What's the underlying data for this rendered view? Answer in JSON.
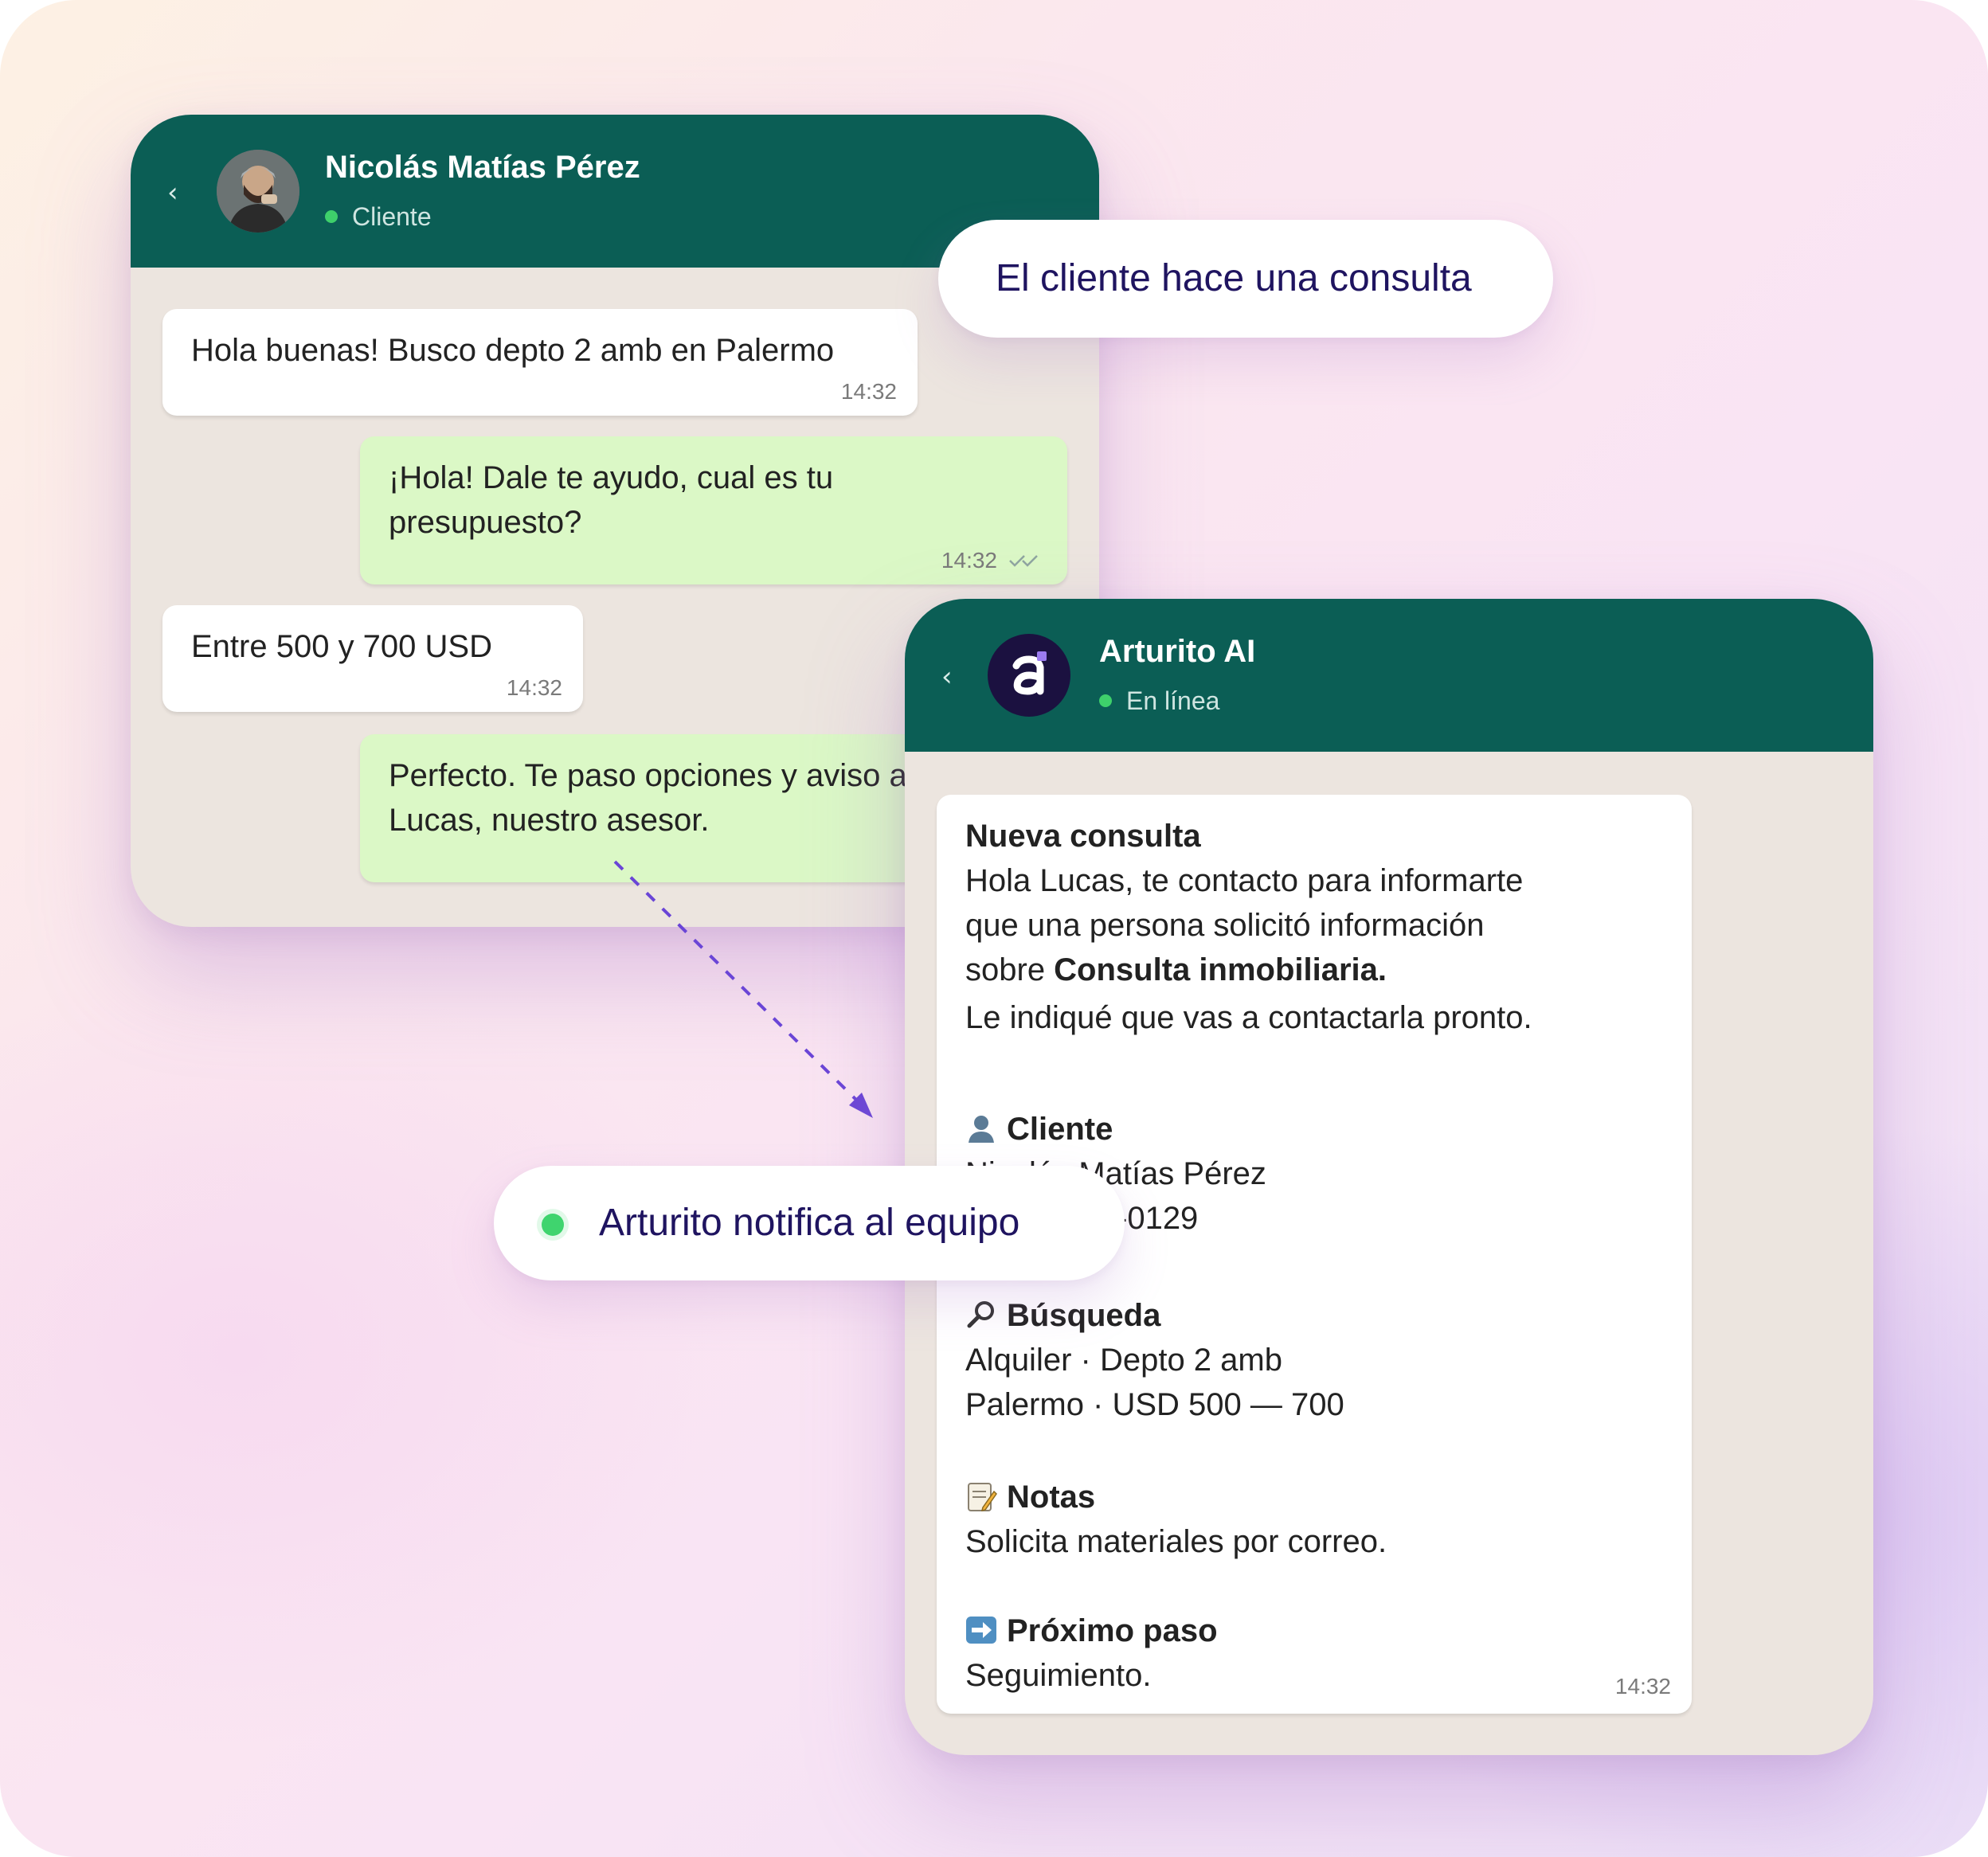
{
  "client_chat": {
    "contact_name": "Nicolás Matías Pérez",
    "status": "Cliente",
    "messages": [
      {
        "text": "Hola buenas!  Busco depto 2 amb en Palermo",
        "time": "14:32"
      },
      {
        "line1": "¡Hola! Dale te ayudo, cual es tu",
        "line2": "presupuesto?",
        "time": "14:32"
      },
      {
        "text": "Entre 500 y 700 USD",
        "time": "14:32"
      },
      {
        "line1": "Perfecto. Te paso opciones y aviso a",
        "line2": "Lucas, nuestro asesor."
      }
    ]
  },
  "labels": {
    "client_query": "El cliente hace una consulta",
    "team_notify": "Arturito notifica al equipo"
  },
  "bot_chat": {
    "contact_name": "Arturito AI",
    "status": "En línea",
    "notification": {
      "title": "Nueva consulta",
      "intro1": "Hola Lucas, te contacto para informarte",
      "intro2": "que una persona solicitó información",
      "intro3_prefix": "sobre ",
      "intro3_bold": "Consulta inmobiliaria.",
      "intro4": "Le indiqué que vas a contactarla pronto.",
      "client_heading": "Cliente",
      "client_name": "Nicolás Matías Pérez",
      "client_phone": "-0129",
      "search_heading": "Búsqueda",
      "search_line1": "Alquiler · Depto 2 amb",
      "search_line2": "Palermo · USD 500 — 700",
      "notes_heading": "Notas",
      "notes_text": "Solicita materiales por correo.",
      "next_heading": "Próximo paso",
      "next_text": "Seguimiento.",
      "time": "14:32"
    }
  }
}
